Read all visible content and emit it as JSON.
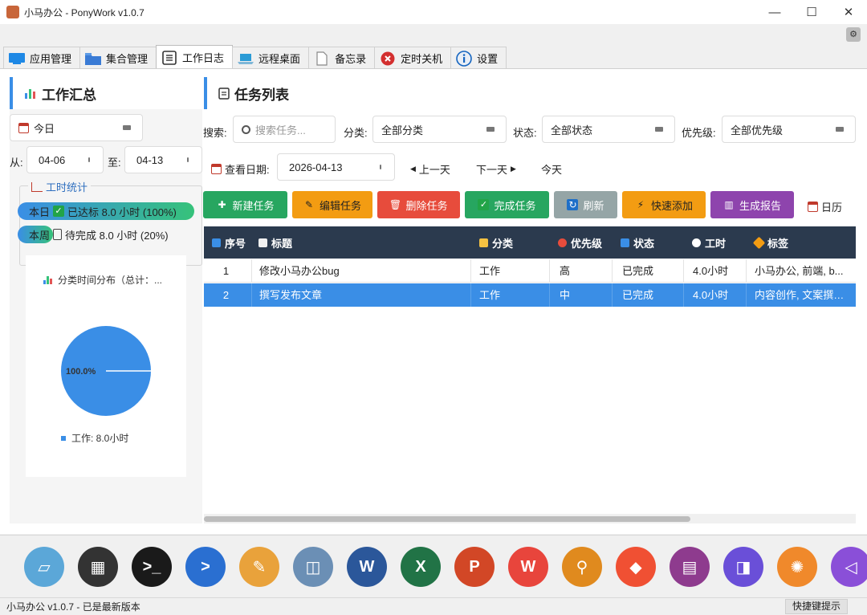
{
  "window": {
    "title": "小马办公 - PonyWork v1.0.7",
    "minimize": "—",
    "maximize": "☐",
    "close": "✕"
  },
  "tabs": [
    {
      "label": "应用管理",
      "icon": "monitor-icon",
      "color": "#1e88e5"
    },
    {
      "label": "集合管理",
      "icon": "folder-icon",
      "color": "#3a7bd5"
    },
    {
      "label": "工作日志",
      "icon": "notebook-icon",
      "color": "#333333"
    },
    {
      "label": "远程桌面",
      "icon": "laptop-icon",
      "color": "#2a9bd6"
    },
    {
      "label": "备忘录",
      "icon": "document-icon",
      "color": "#888888"
    },
    {
      "label": "定时关机",
      "icon": "shutdown-icon",
      "color": "#d32f2f"
    },
    {
      "label": "设置",
      "icon": "info-icon",
      "color": "#1565c0"
    }
  ],
  "summary": {
    "title": "工作汇总",
    "period": "今日",
    "from_label": "从:",
    "from": "04-06",
    "to_label": "至:",
    "to": "04-13",
    "stats_title": "工时统计",
    "today_label": "本日",
    "today_status": "已达标 8.0 小时 (100%)",
    "today_progress": 1.0,
    "week_label": "本周",
    "week_status": "待完成 8.0 小时 (20%)",
    "week_progress": 0.2,
    "pie_title": "分类时间分布（总计：...",
    "pie_percent": "100.0%",
    "pie_legend": "工作: 8.0小时",
    "pie_color": "#3a8ee6"
  },
  "tasks": {
    "title": "任务列表",
    "search_label": "搜索:",
    "search_placeholder": "搜索任务...",
    "category_label": "分类:",
    "category_value": "全部分类",
    "status_label": "状态:",
    "status_value": "全部状态",
    "priority_label": "优先级:",
    "priority_value": "全部优先级",
    "date_label": "查看日期:",
    "date_value": "2026-04-13",
    "prev_day": "上一天",
    "next_day": "下一天",
    "today": "今天",
    "buttons": {
      "new": "新建任务",
      "edit": "编辑任务",
      "delete": "删除任务",
      "complete": "完成任务",
      "refresh": "刷新",
      "quick_add": "快速添加",
      "report": "生成报告",
      "calendar": "日历"
    },
    "columns": [
      "序号",
      "标题",
      "分类",
      "优先级",
      "状态",
      "工时",
      "标签"
    ],
    "rows": [
      [
        "1",
        "修改小马办公bug",
        "工作",
        "高",
        "已完成",
        "4.0小时",
        "小马办公, 前端, b..."
      ],
      [
        "2",
        "撰写发布文章",
        "工作",
        "中",
        "已完成",
        "4.0小时",
        "内容创作, 文案撰写..."
      ]
    ]
  },
  "dock": [
    {
      "name": "notepad-icon",
      "color": "#5ba7d8",
      "glyph": "▱"
    },
    {
      "name": "calculator-icon",
      "color": "#333333",
      "glyph": "▦"
    },
    {
      "name": "terminal-icon",
      "color": "#1a1a1a",
      "glyph": ">_"
    },
    {
      "name": "powershell-icon",
      "color": "#2a6fd1",
      "glyph": ">"
    },
    {
      "name": "paint-icon",
      "color": "#e9a23b",
      "glyph": "✎"
    },
    {
      "name": "resource-monitor-icon",
      "color": "#6b8fb5",
      "glyph": "◫"
    },
    {
      "name": "word-icon",
      "color": "#2b579a",
      "glyph": "W"
    },
    {
      "name": "excel-icon",
      "color": "#217346",
      "glyph": "X"
    },
    {
      "name": "powerpoint-icon",
      "color": "#d24726",
      "glyph": "P"
    },
    {
      "name": "wps-icon",
      "color": "#e8453c",
      "glyph": "W"
    },
    {
      "name": "search-tool-icon",
      "color": "#e08a1e",
      "glyph": "⚲"
    },
    {
      "name": "git-icon",
      "color": "#f05033",
      "glyph": "◆"
    },
    {
      "name": "winrar-icon",
      "color": "#8e3b8e",
      "glyph": "▤"
    },
    {
      "name": "remote-app-icon",
      "color": "#6a4fd8",
      "glyph": "◨"
    },
    {
      "name": "pinwheel-icon",
      "color": "#f0892b",
      "glyph": "✺"
    },
    {
      "name": "visual-studio-icon",
      "color": "#8a4fd8",
      "glyph": "◁"
    }
  ],
  "status": {
    "text": "小马办公 v1.0.7 - 已是最新版本",
    "hint": "快捷键提示"
  }
}
